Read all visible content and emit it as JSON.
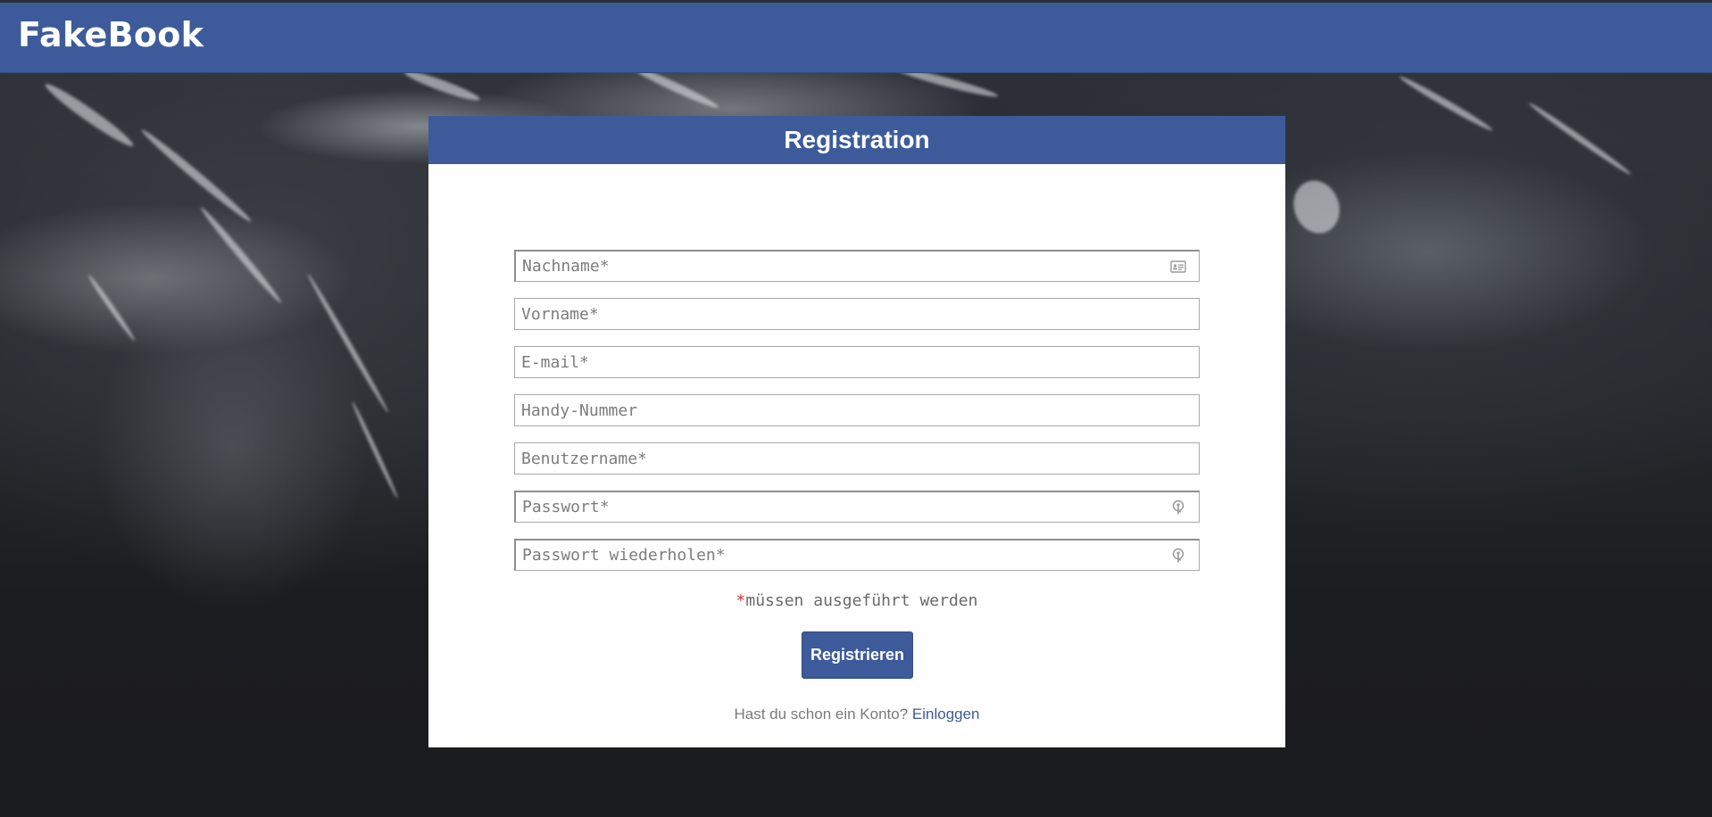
{
  "app": {
    "brand": "FakeBook"
  },
  "registration": {
    "title": "Registration",
    "fields": {
      "lastname_placeholder": "Nachname*",
      "firstname_placeholder": "Vorname*",
      "email_placeholder": "E-mail*",
      "phone_placeholder": "Handy-Nummer",
      "username_placeholder": "Benutzername*",
      "password_placeholder": "Passwort*",
      "password_repeat_placeholder": "Passwort wiederholen*"
    },
    "required_star": "*",
    "required_note": "müssen ausgeführt werden",
    "register_label": "Registrieren",
    "login_prompt": "Hast du schon ein Konto?",
    "login_link": "Einloggen"
  },
  "icons": {
    "lastname_field": "contact-card-icon",
    "password_field": "key-icon",
    "password_repeat_field": "key-icon"
  },
  "colors": {
    "brand_blue": "#3d5b9b",
    "required_red": "#c0392b"
  }
}
